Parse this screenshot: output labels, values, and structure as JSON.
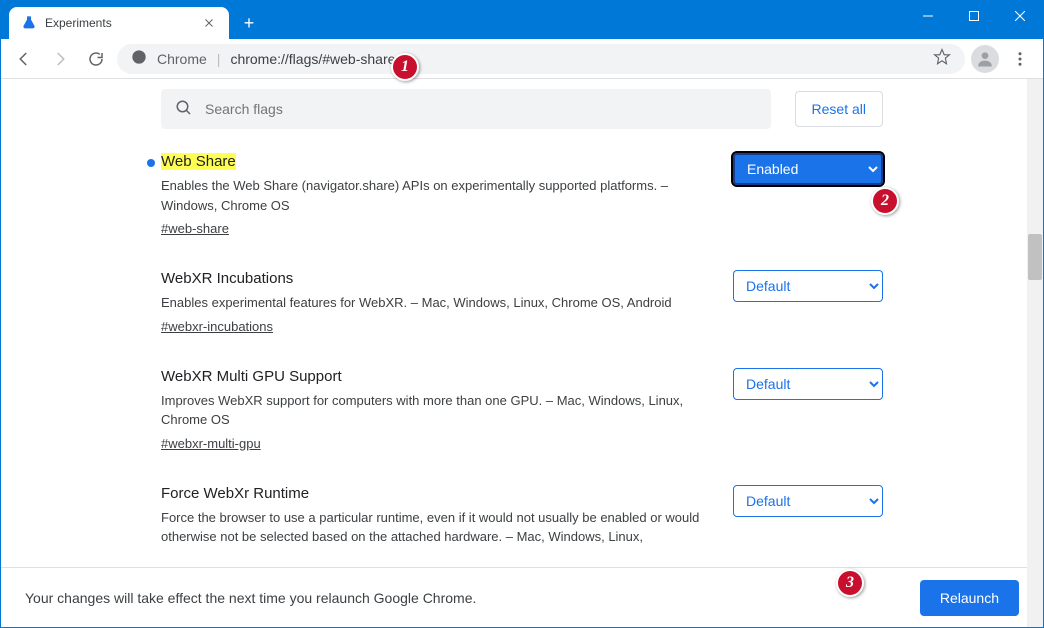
{
  "window": {
    "tab_title": "Experiments"
  },
  "omnibox": {
    "origin": "Chrome",
    "url": "chrome://flags/#web-share"
  },
  "search": {
    "placeholder": "Search flags",
    "reset_label": "Reset all"
  },
  "flags": [
    {
      "title": "Web Share",
      "desc": "Enables the Web Share (navigator.share) APIs on experimentally supported platforms. – Windows, Chrome OS",
      "link": "#web-share",
      "value": "Enabled",
      "highlighted": true,
      "modified": true
    },
    {
      "title": "WebXR Incubations",
      "desc": "Enables experimental features for WebXR. – Mac, Windows, Linux, Chrome OS, Android",
      "link": "#webxr-incubations",
      "value": "Default",
      "highlighted": false,
      "modified": false
    },
    {
      "title": "WebXR Multi GPU Support",
      "desc": "Improves WebXR support for computers with more than one GPU. – Mac, Windows, Linux, Chrome OS",
      "link": "#webxr-multi-gpu",
      "value": "Default",
      "highlighted": false,
      "modified": false
    },
    {
      "title": "Force WebXr Runtime",
      "desc": "Force the browser to use a particular runtime, even if it would not usually be enabled or would otherwise not be selected based on the attached hardware. – Mac, Windows, Linux,",
      "link": "",
      "value": "Default",
      "highlighted": false,
      "modified": false
    }
  ],
  "relaunch": {
    "message": "Your changes will take effect the next time you relaunch Google Chrome.",
    "button": "Relaunch"
  },
  "callouts": {
    "one": "1",
    "two": "2",
    "three": "3"
  }
}
